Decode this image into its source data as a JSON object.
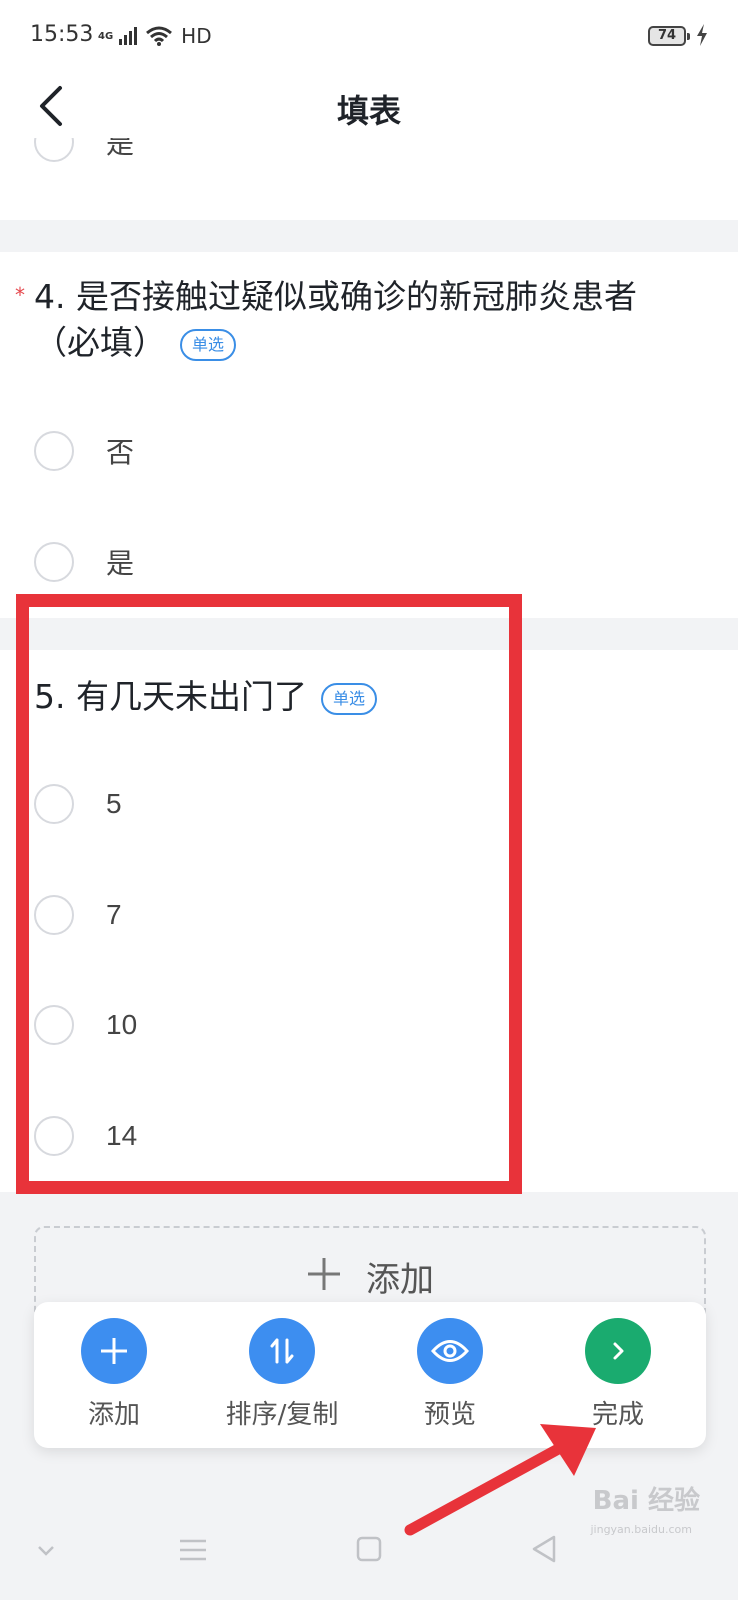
{
  "status": {
    "time": "15:53",
    "network": "4G",
    "wifi_label": "HD",
    "battery": "74"
  },
  "nav": {
    "title": "填表"
  },
  "question3": {
    "options": [
      "是"
    ]
  },
  "question4": {
    "title": "4. 是否接触过疑似或确诊的新冠肺炎患者（必填）",
    "required_mark": "*",
    "tag": "单选",
    "options": [
      "否",
      "是"
    ]
  },
  "question5": {
    "title": "5. 有几天未出门了",
    "tag": "单选",
    "options": [
      "5",
      "7",
      "10",
      "14"
    ]
  },
  "add_field": {
    "label": "添加"
  },
  "toolbar": {
    "items": [
      {
        "label": "添加",
        "icon": "plus-icon",
        "color": "#3d8ef0"
      },
      {
        "label": "排序/复制",
        "icon": "sort-icon",
        "color": "#3d8ef0"
      },
      {
        "label": "预览",
        "icon": "eye-icon",
        "color": "#3d8ef0"
      },
      {
        "label": "完成",
        "icon": "chevron-right-icon",
        "color": "#1aab6f"
      }
    ]
  },
  "watermark": {
    "text": "Bai 经验",
    "sub": "jingyan.baidu.com"
  },
  "colors": {
    "highlight": "#e8333a",
    "accent_blue": "#3d8ef0",
    "accent_green": "#1aab6f"
  }
}
